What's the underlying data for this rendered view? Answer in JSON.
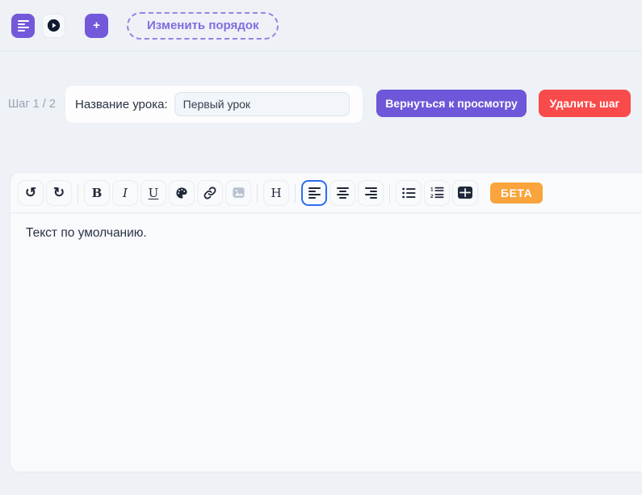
{
  "header": {
    "add_button_label": "+",
    "reorder_button_label": "Изменить порядок",
    "icons": {
      "steps_list": "align-left-lines-icon",
      "play": "play-circle-icon"
    }
  },
  "step_bar": {
    "step_indicator": "Шаг 1 / 2",
    "lesson_name_label": "Название урока:",
    "lesson_name_value": "Первый урок",
    "back_to_preview_label": "Вернуться к просмотру",
    "delete_step_label": "Удалить шаг"
  },
  "editor": {
    "toolbar": {
      "undo_glyph": "↺",
      "redo_glyph": "↻",
      "bold": "B",
      "italic": "I",
      "underline": "U",
      "heading": "H",
      "beta_badge": "БЕТА",
      "active_button": "align-left",
      "icons": [
        "undo",
        "redo",
        "bold",
        "italic",
        "underline",
        "text-color-palette",
        "link",
        "image",
        "heading",
        "align-left",
        "align-center",
        "align-right",
        "bullet-list",
        "ordered-list",
        "table"
      ]
    },
    "content_text": "Текст по умолчанию."
  },
  "colors": {
    "page_bg": "#eef1f6",
    "panel_bg": "#f8fafc",
    "accent_purple": "#7358da",
    "button_purple": "#6e57d8",
    "danger_red": "#f94b4b",
    "beta_orange": "#f9a43c",
    "active_ring_blue": "#2a6df5",
    "icon_navy": "#1f2838",
    "muted_gray": "#9aa3b3"
  }
}
